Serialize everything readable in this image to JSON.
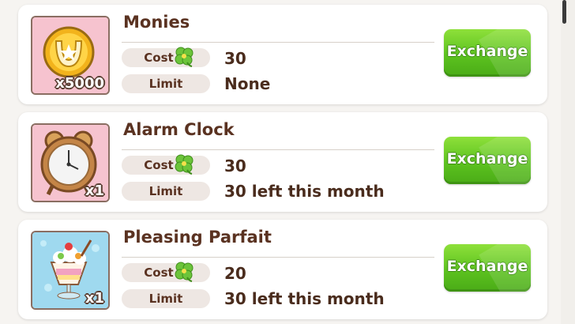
{
  "labels": {
    "cost": "Cost",
    "limit": "Limit",
    "exchange": "Exchange"
  },
  "colors": {
    "button": "#5cc21f",
    "title": "#5a3221",
    "card": "#ffffff"
  },
  "items": [
    {
      "name": "Monies",
      "quantity": "x5000",
      "cost": "30",
      "limit": "None",
      "icon": "horseshoe-coin-icon"
    },
    {
      "name": "Alarm Clock",
      "quantity": "x1",
      "cost": "30",
      "limit": "30 left this month",
      "icon": "alarm-clock-icon"
    },
    {
      "name": "Pleasing Parfait",
      "quantity": "x1",
      "cost": "20",
      "limit": "30 left this month",
      "icon": "parfait-icon"
    }
  ]
}
